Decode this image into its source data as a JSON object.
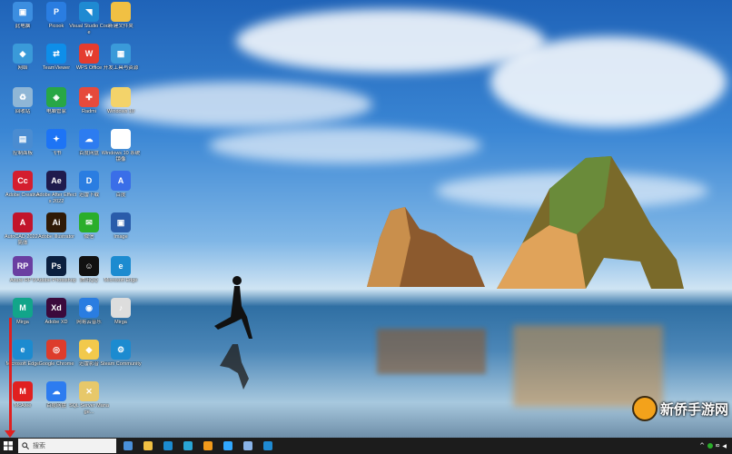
{
  "desktop": {
    "icons": [
      {
        "label": "此电脑",
        "color": "#3c8ee0",
        "glyph": "▣"
      },
      {
        "label": "Picook",
        "color": "#2a7de1",
        "glyph": "P"
      },
      {
        "label": "Visual Studio Code",
        "color": "#1f8ad2",
        "glyph": "◥"
      },
      {
        "label": "新建文件夹",
        "color": "#f1c043",
        "glyph": ""
      },
      {
        "label": "网络",
        "color": "#3a9ad9",
        "glyph": "◆"
      },
      {
        "label": "TeamViewer",
        "color": "#0e8ee9",
        "glyph": "⇄"
      },
      {
        "label": "WPS Office",
        "color": "#e43c2f",
        "glyph": "W"
      },
      {
        "label": "开发工具与资源",
        "color": "#3a9ad9",
        "glyph": "▦"
      },
      {
        "label": "回收站",
        "color": "#8fb6d6",
        "glyph": "♻"
      },
      {
        "label": "电脑管家",
        "color": "#28a745",
        "glyph": "◈"
      },
      {
        "label": "Radmi",
        "color": "#e64a3c",
        "glyph": "✚"
      },
      {
        "label": "Windows 10",
        "color": "#f3d36a",
        "glyph": ""
      },
      {
        "label": "控制面板",
        "color": "#4a8cd1",
        "glyph": "▤"
      },
      {
        "label": "飞书",
        "color": "#1d74f5",
        "glyph": "✦"
      },
      {
        "label": "百度网盘",
        "color": "#2d7cf0",
        "glyph": "☁"
      },
      {
        "label": "Windows 10 系统镜像",
        "color": "#ffffff",
        "glyph": ""
      },
      {
        "label": "Adobe Creative",
        "color": "#d41e2f",
        "glyph": "Cc"
      },
      {
        "label": "Adobe After Effects 2022",
        "color": "#1f1b4d",
        "glyph": "Ae"
      },
      {
        "label": "迅雷下载",
        "color": "#2a7de1",
        "glyph": "D"
      },
      {
        "label": "百度",
        "color": "#3a6ee8",
        "glyph": "A"
      },
      {
        "label": "AutoCAD 2022 - 简体",
        "color": "#c2142b",
        "glyph": "A"
      },
      {
        "label": "Adobe Illustrator",
        "color": "#2f1a06",
        "glyph": "Ai"
      },
      {
        "label": "微信",
        "color": "#2aae2a",
        "glyph": "✉"
      },
      {
        "label": "Image",
        "color": "#2a5caa",
        "glyph": "▣"
      },
      {
        "label": "Axure RP 9",
        "color": "#6a3ea1",
        "glyph": "RP"
      },
      {
        "label": "Adobe Photoshop",
        "color": "#0b1f3f",
        "glyph": "Ps"
      },
      {
        "label": "腾讯QQ",
        "color": "#111111",
        "glyph": "☺"
      },
      {
        "label": "Microsoft Edge",
        "color": "#1c8bd0",
        "glyph": "e"
      },
      {
        "label": "Mirga",
        "color": "#12a58a",
        "glyph": "M"
      },
      {
        "label": "Adobe XD",
        "color": "#3b0a3c",
        "glyph": "Xd"
      },
      {
        "label": "网易云音乐",
        "color": "#2a7de1",
        "glyph": "◉"
      },
      {
        "label": "Mirga",
        "color": "#dddddd",
        "glyph": "♪"
      },
      {
        "label": "Microsoft Edge",
        "color": "#1c8bd0",
        "glyph": "e"
      },
      {
        "label": "Google Chrome",
        "color": "#dd3c2c",
        "glyph": "◎"
      },
      {
        "label": "迅雷影音",
        "color": "#f2c94c",
        "glyph": "◆"
      },
      {
        "label": "Steam Community",
        "color": "#1c8bd0",
        "glyph": "⚙"
      },
      {
        "label": "McAfee",
        "color": "#e02020",
        "glyph": "M"
      },
      {
        "label": "百度网盘",
        "color": "#2d7cf0",
        "glyph": "☁"
      },
      {
        "label": "SQL Server Manage...",
        "color": "#e7c86a",
        "glyph": "✕"
      }
    ]
  },
  "taskbar": {
    "start_icon": "windows-logo-icon",
    "search_placeholder": "搜索",
    "apps": [
      {
        "name": "avatar",
        "color": "#4a90d9"
      },
      {
        "name": "file-explorer",
        "color": "#f1c043"
      },
      {
        "name": "edge",
        "color": "#1c8bd0"
      },
      {
        "name": "edge-beta",
        "color": "#2aa6d6"
      },
      {
        "name": "illustrator",
        "color": "#f29a1b"
      },
      {
        "name": "photoshop",
        "color": "#31a8ff"
      },
      {
        "name": "wps",
        "color": "#8ab4e8"
      },
      {
        "name": "vscode",
        "color": "#1f8ad2"
      }
    ],
    "tray": {
      "expand": "^",
      "status": "ఐ"
    }
  },
  "watermark": {
    "text": "新侨手游网"
  }
}
